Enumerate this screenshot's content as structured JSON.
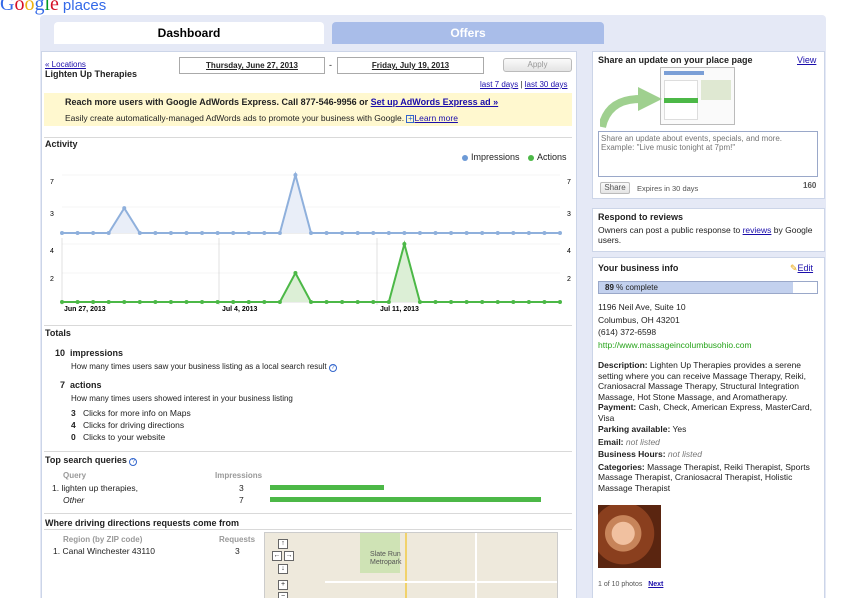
{
  "logo": {
    "text": "Google",
    "suffix": "places"
  },
  "tabs": {
    "dashboard": "Dashboard",
    "offers": "Offers"
  },
  "header": {
    "locations_link": "« Locations",
    "business_name": "Lighten Up Therapies",
    "date_from": "Thursday, June 27, 2013",
    "date_sep": "-",
    "date_to": "Friday, July 19, 2013",
    "apply": "Apply",
    "last7": "last 7 days",
    "range_sep": " | ",
    "last30": "last 30 days"
  },
  "promo": {
    "headline": "Reach more users with Google AdWords Express. Call 877-546-9956 or",
    "headline_link": "Set up AdWords Express ad »",
    "body": "Easily create automatically-managed AdWords ads to promote your business with Google.",
    "learn_more": "Learn more"
  },
  "activity": {
    "title": "Activity",
    "legend_impressions": "Impressions",
    "legend_actions": "Actions",
    "impressions_ticks": [
      "7",
      "3"
    ],
    "actions_ticks": [
      "4",
      "2"
    ],
    "x_labels": [
      "Jun 27, 2013",
      "Jul 4, 2013",
      "Jul 11, 2013"
    ]
  },
  "chart_data": [
    {
      "type": "area",
      "series": [
        {
          "name": "Impressions",
          "values": [
            0,
            0,
            0,
            0,
            0,
            0,
            3,
            0,
            0,
            0,
            0,
            0,
            0,
            0,
            0,
            0,
            0,
            0,
            0,
            0,
            0,
            0,
            0,
            0,
            0,
            0,
            0,
            0,
            0,
            0,
            0,
            0,
            0
          ]
        }
      ],
      "ylim": [
        0,
        7
      ],
      "color": "#8fb0dc"
    },
    {
      "type": "area",
      "series": [
        {
          "name": "Actions",
          "values": [
            0,
            0,
            0,
            0,
            0,
            0,
            0,
            0,
            0,
            0,
            0,
            0,
            0,
            0,
            0,
            0,
            0,
            0,
            0,
            0,
            0,
            0,
            0,
            0,
            0,
            0,
            0,
            0,
            0,
            0,
            0,
            0,
            0
          ]
        }
      ],
      "ylim": [
        0,
        4
      ],
      "color": "#4cb847"
    }
  ],
  "impressions_values": [
    0,
    0,
    0,
    0,
    0,
    0,
    3,
    0,
    0,
    0,
    0,
    0,
    0,
    0,
    0,
    0,
    0,
    0,
    0,
    0,
    0,
    0,
    0,
    0,
    0,
    0,
    0,
    0,
    0,
    0,
    0,
    0,
    0
  ],
  "totals": {
    "title": "Totals",
    "impressions_count": "10",
    "impressions_label": "impressions",
    "impressions_desc": "How many times users saw your business listing as a local search result",
    "actions_count": "7",
    "actions_label": "actions",
    "actions_desc": "How many times users showed interest in your business listing",
    "breakdown": [
      {
        "count": "3",
        "label": "Clicks for more info on Maps"
      },
      {
        "count": "4",
        "label": "Clicks for driving directions"
      },
      {
        "count": "0",
        "label": "Clicks to your website"
      }
    ]
  },
  "queries": {
    "title": "Top search queries",
    "col_query": "Query",
    "col_impressions": "Impressions",
    "rows": [
      {
        "num": "1.",
        "query": "lighten up therapies,",
        "impressions": "3",
        "fraction": 0.42
      },
      {
        "num": "",
        "query": "Other",
        "impressions": "7",
        "fraction": 0.98
      }
    ]
  },
  "directions": {
    "title": "Where driving directions requests come from",
    "col_region": "Region (by ZIP code)",
    "col_requests": "Requests",
    "rows": [
      {
        "num": "1.",
        "region": "Canal Winchester 43110",
        "requests": "3"
      }
    ],
    "map_label": "Slate Run Metropark"
  },
  "share": {
    "title": "Share an update on your place page",
    "view": "View",
    "placeholder": "Share an update about events, specials, and more. Example: \"Live music tonight at 7pm!\"",
    "button": "Share",
    "expires": "Expires in 30 days",
    "chars_left": "160"
  },
  "reviews": {
    "title": "Respond to reviews",
    "body_pre": "Owners can post a public response to",
    "link": "reviews",
    "body_post": "by Google users."
  },
  "business": {
    "title": "Your business info",
    "edit": "Edit",
    "percent": "89",
    "percent_suffix": "% complete",
    "completion": 0.89,
    "address1": "1196 Neil Ave, Suite 10",
    "address2": "Columbus, OH 43201",
    "phone": "(614) 372-6598",
    "website": "http://www.massageincolumbusohio.com",
    "description_label": "Description:",
    "description": "Lighten Up Therapies provides a serene setting where you can receive Massage Therapy, Reiki, Craniosacral Massage Therapy, Structural Integration Massage, Hot Stone Massage, and Aromatherapy.",
    "payment_label": "Payment:",
    "payment": "Cash, Check, American Express, MasterCard, Visa",
    "parking_label": "Parking available:",
    "parking": "Yes",
    "email_label": "Email:",
    "email": "not listed",
    "hours_label": "Business Hours:",
    "hours": "not listed",
    "categories_label": "Categories:",
    "categories": "Massage Therapist, Reiki Therapist, Sports Massage Therapist, Craniosacral Therapist, Holistic Massage Therapist",
    "photos": "1 of 10 photos",
    "next": "Next"
  }
}
